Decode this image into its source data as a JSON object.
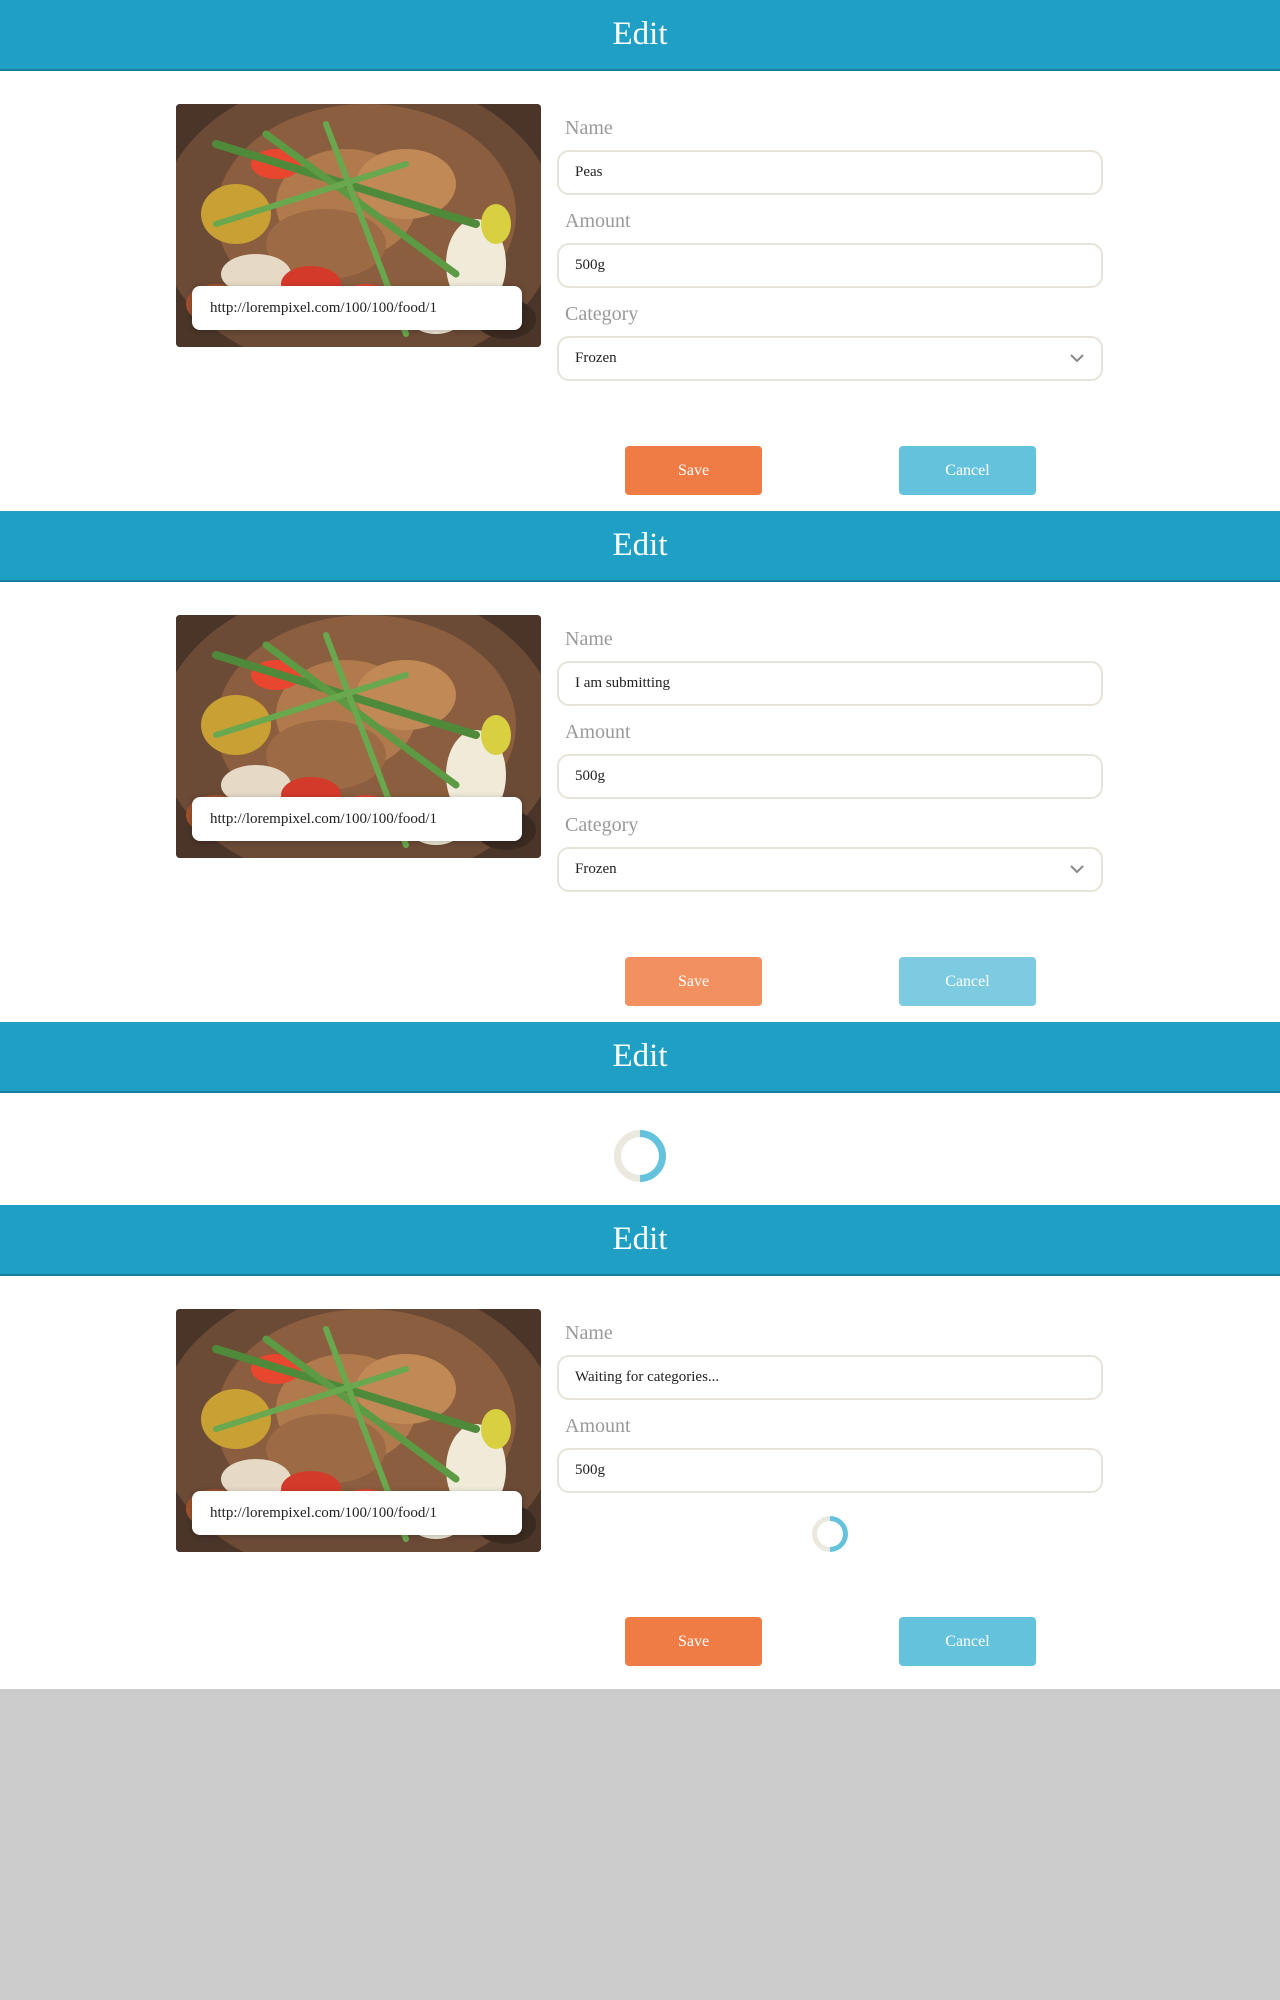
{
  "colors": {
    "header": "#1f9fc4",
    "save": "#ef7c45",
    "cancel": "#65c2dc",
    "spinner": "#65c2dc",
    "background": "#cccccc"
  },
  "panels": [
    {
      "header": "Edit",
      "image_url": "http://lorempixel.com/100/100/food/1",
      "name_label": "Name",
      "name_value": "Peas",
      "amount_label": "Amount",
      "amount_value": "500g",
      "category_label": "Category",
      "category_value": "Frozen",
      "save_label": "Save",
      "cancel_label": "Cancel"
    },
    {
      "header": "Edit",
      "image_url": "http://lorempixel.com/100/100/food/1",
      "name_label": "Name",
      "name_value": "I am submitting",
      "amount_label": "Amount",
      "amount_value": "500g",
      "category_label": "Category",
      "category_value": "Frozen",
      "save_label": "Save",
      "cancel_label": "Cancel"
    },
    {
      "header": "Edit"
    },
    {
      "header": "Edit",
      "image_url": "http://lorempixel.com/100/100/food/1",
      "name_label": "Name",
      "name_value": "Waiting for categories...",
      "amount_label": "Amount",
      "amount_value": "500g",
      "save_label": "Save",
      "cancel_label": "Cancel"
    }
  ]
}
